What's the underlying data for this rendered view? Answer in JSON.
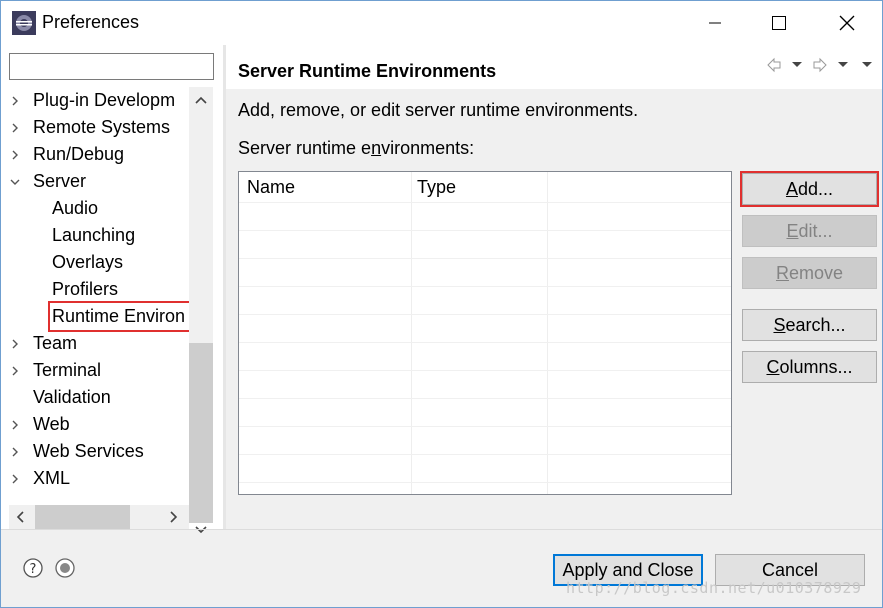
{
  "window": {
    "title": "Preferences"
  },
  "filter": {
    "value": ""
  },
  "tree": {
    "items": [
      {
        "label": "Plug-in Developm",
        "expandable": true,
        "expanded": false
      },
      {
        "label": "Remote Systems",
        "expandable": true,
        "expanded": false
      },
      {
        "label": "Run/Debug",
        "expandable": true,
        "expanded": false
      },
      {
        "label": "Server",
        "expandable": true,
        "expanded": true
      },
      {
        "label": "Audio",
        "child": true
      },
      {
        "label": "Launching",
        "child": true
      },
      {
        "label": "Overlays",
        "child": true
      },
      {
        "label": "Profilers",
        "child": true
      },
      {
        "label": "Runtime Environ",
        "child": true,
        "selected": true
      },
      {
        "label": "Team",
        "expandable": true,
        "expanded": false
      },
      {
        "label": "Terminal",
        "expandable": true,
        "expanded": false
      },
      {
        "label": "Validation",
        "expandable": false
      },
      {
        "label": "Web",
        "expandable": true,
        "expanded": false
      },
      {
        "label": "Web Services",
        "expandable": true,
        "expanded": false
      },
      {
        "label": "XML",
        "expandable": true,
        "expanded": false
      }
    ]
  },
  "page": {
    "title": "Server Runtime Environments",
    "description": "Add, remove, or edit server runtime environments.",
    "list_label_pre": "Server runtime e",
    "list_label_mnemonic": "n",
    "list_label_post": "vironments:",
    "table": {
      "columns": [
        "Name",
        "Type"
      ]
    }
  },
  "buttons": {
    "add": {
      "mnemonic": "A",
      "rest": "dd..."
    },
    "edit": {
      "mnemonic": "E",
      "rest": "dit..."
    },
    "remove": {
      "mnemonic": "R",
      "rest": "emove"
    },
    "search": {
      "mnemonic": "S",
      "rest": "earch..."
    },
    "columns": {
      "mnemonic": "C",
      "rest": "olumns..."
    }
  },
  "footer": {
    "apply_close": "Apply and Close",
    "cancel": "Cancel"
  },
  "watermark": "http://blog.csdn.net/u010378929",
  "colors": {
    "highlight_red": "#e0302f",
    "default_button_border": "#0078d7"
  }
}
